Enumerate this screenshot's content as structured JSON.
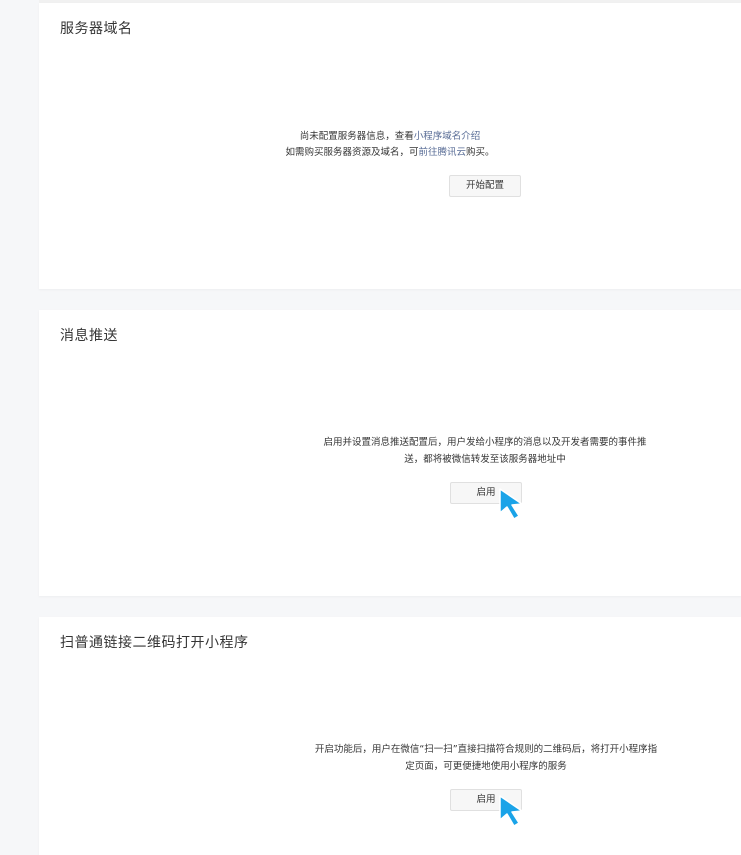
{
  "sections": {
    "server_domain": {
      "title": "服务器域名",
      "line1_text": "尚未配置服务器信息，查看",
      "line1_link": "小程序域名介绍",
      "line2_text_before": "如需购买服务器资源及域名，可",
      "line2_link": "前往腾讯云",
      "line2_text_after": "购买。",
      "button_label": "开始配置"
    },
    "message_push": {
      "title": "消息推送",
      "desc_line1": "启用并设置消息推送配置后，用户发给小程序的消息以及开发者需要的事件推",
      "desc_line2": "送，都将被微信转发至该服务器地址中",
      "button_label": "启用"
    },
    "qrcode": {
      "title": "扫普通链接二维码打开小程序",
      "desc_line1": "开启功能后，用户在微信“扫一扫”直接扫描符合规则的二维码后，将打开小程序指",
      "desc_line2": "定页面，可更便捷地使用小程序的服务",
      "button_label": "启用"
    }
  },
  "colors": {
    "link": "#576b95",
    "cursor_fill": "#1aa3e8",
    "background": "#f6f7f9",
    "card": "#ffffff"
  },
  "icons": {
    "pointer": "arrow-cursor-icon"
  }
}
